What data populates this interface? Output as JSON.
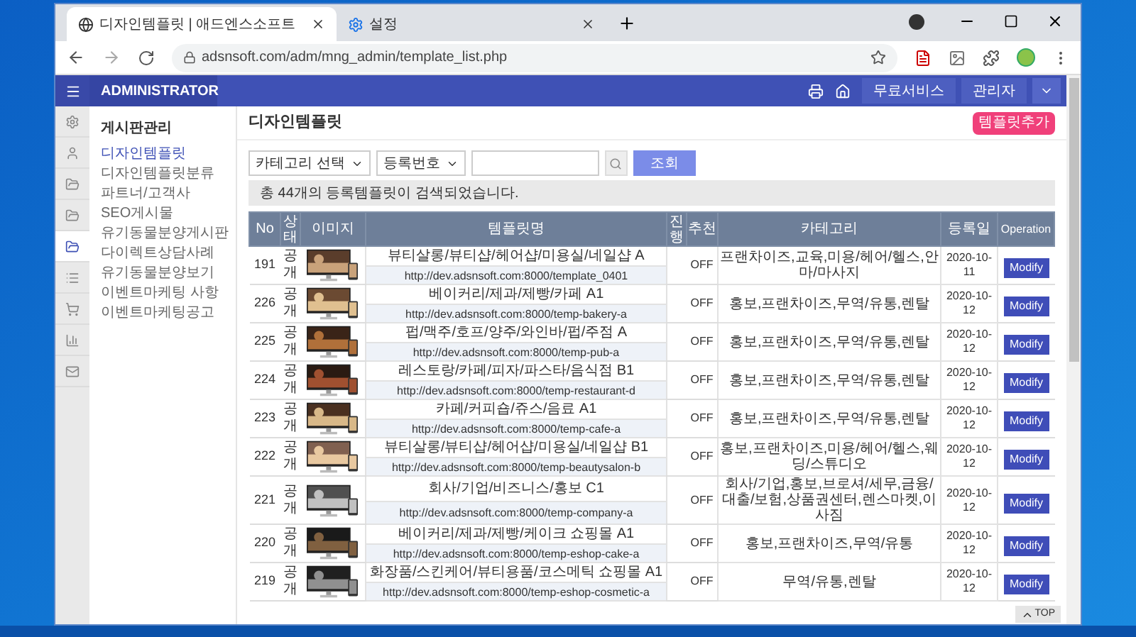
{
  "browser": {
    "tabs": [
      {
        "title": "디자인템플릿 | 애드엔스소프트",
        "selected": true
      },
      {
        "title": "설정",
        "selected": false
      }
    ],
    "url": "adsnsoft.com/adm/mng_admin/template_list.php"
  },
  "header": {
    "brand": "ADMINISTRATOR",
    "buttons": [
      "무료서비스",
      "관리자"
    ]
  },
  "rail": [
    {
      "kind": "gear",
      "selected": false
    },
    {
      "kind": "user",
      "selected": false
    },
    {
      "kind": "folder",
      "selected": false
    },
    {
      "kind": "folder",
      "selected": false
    },
    {
      "kind": "folder",
      "selected": true
    },
    {
      "kind": "list",
      "selected": false
    },
    {
      "kind": "cart",
      "selected": false
    },
    {
      "kind": "chart",
      "selected": false
    },
    {
      "kind": "mail",
      "selected": false
    }
  ],
  "menu": {
    "title": "게시판관리",
    "items": [
      {
        "label": "디자인템플릿",
        "selected": true
      },
      {
        "label": "디자인템플릿분류",
        "selected": false
      },
      {
        "label": "파트너/고객사",
        "selected": false
      },
      {
        "label": "SEO게시물",
        "selected": false
      },
      {
        "label": "유기동물분양게시판",
        "selected": false
      },
      {
        "label": "다이렉트상담사례",
        "selected": false
      },
      {
        "label": "유기동물분양보기",
        "selected": false
      },
      {
        "label": "이벤트마케팅 사항",
        "selected": false
      },
      {
        "label": "이벤트마케팅공고",
        "selected": false
      }
    ]
  },
  "page": {
    "title": "디자인템플릿",
    "add_button": "템플릿추가"
  },
  "filter": {
    "selects": [
      "카테고리 선택",
      "등록번호"
    ],
    "button": "조회"
  },
  "message": "총 44개의 등록템플릿이 검색되었습니다.",
  "table": {
    "columns": [
      "No",
      "상태",
      "이미지",
      "템플릿명",
      "진행",
      "추천",
      "카테고리",
      "등록일",
      "Operation"
    ],
    "rows": [
      {
        "no": "191",
        "status": "공개",
        "name": "뷰티살롱/뷰티샵/헤어샵/미용실/네일샵 A",
        "url": "http://dev.adsnsoft.com:8000/template_0401",
        "recommend": "OFF",
        "category": "프랜차이즈,교육,미용/헤어/헬스,안마/마사지",
        "date": "2020-10-11",
        "action": "Modify"
      },
      {
        "no": "226",
        "status": "공개",
        "name": "베이커리/제과/제빵/카페 A1",
        "url": "http://dev.adsnsoft.com:8000/temp-bakery-a",
        "recommend": "OFF",
        "category": "홍보,프랜차이즈,무역/유통,렌탈",
        "date": "2020-10-12",
        "action": "Modify"
      },
      {
        "no": "225",
        "status": "공개",
        "name": "펍/맥주/호프/양주/와인바/펍/주점 A",
        "url": "http://dev.adsnsoft.com:8000/temp-pub-a",
        "recommend": "OFF",
        "category": "홍보,프랜차이즈,무역/유통,렌탈",
        "date": "2020-10-12",
        "action": "Modify"
      },
      {
        "no": "224",
        "status": "공개",
        "name": "레스토랑/카페/피자/파스타/음식점 B1",
        "url": "http://dev.adsnsoft.com:8000/temp-restaurant-d",
        "recommend": "OFF",
        "category": "홍보,프랜차이즈,무역/유통,렌탈",
        "date": "2020-10-12",
        "action": "Modify"
      },
      {
        "no": "223",
        "status": "공개",
        "name": "카페/커피숍/쥬스/음료 A1",
        "url": "http://dev.adsnsoft.com:8000/temp-cafe-a",
        "recommend": "OFF",
        "category": "홍보,프랜차이즈,무역/유통,렌탈",
        "date": "2020-10-12",
        "action": "Modify"
      },
      {
        "no": "222",
        "status": "공개",
        "name": "뷰티살롱/뷰티샵/헤어샵/미용실/네일샵 B1",
        "url": "http://dev.adsnsoft.com:8000/temp-beautysalon-b",
        "recommend": "OFF",
        "category": "홍보,프랜차이즈,미용/헤어/헬스,웨딩/스튜디오",
        "date": "2020-10-12",
        "action": "Modify"
      },
      {
        "no": "221",
        "status": "공개",
        "name": "회사/기업/비즈니스/홍보 C1",
        "url": "http://dev.adsnsoft.com:8000/temp-company-a",
        "recommend": "OFF",
        "category": "회사/기업,홍보,브로셔/세무,금융/대출/보험,상품권센터,렌스마켓,이사짐",
        "date": "2020-10-12",
        "action": "Modify"
      },
      {
        "no": "220",
        "status": "공개",
        "name": "베이커리/제과/제빵/케이크 쇼핑몰 A1",
        "url": "http://dev.adsnsoft.com:8000/temp-eshop-cake-a",
        "recommend": "OFF",
        "category": "홍보,프랜차이즈,무역/유통",
        "date": "2020-10-12",
        "action": "Modify"
      },
      {
        "no": "219",
        "status": "공개",
        "name": "화장품/스킨케어/뷰티용품/코스메틱 쇼핑몰 A1",
        "url": "http://dev.adsnsoft.com:8000/temp-eshop-cosmetic-a",
        "recommend": "OFF",
        "category": "무역/유통,렌탈",
        "date": "2020-10-12",
        "action": "Modify"
      }
    ]
  },
  "top_button": "TOP"
}
